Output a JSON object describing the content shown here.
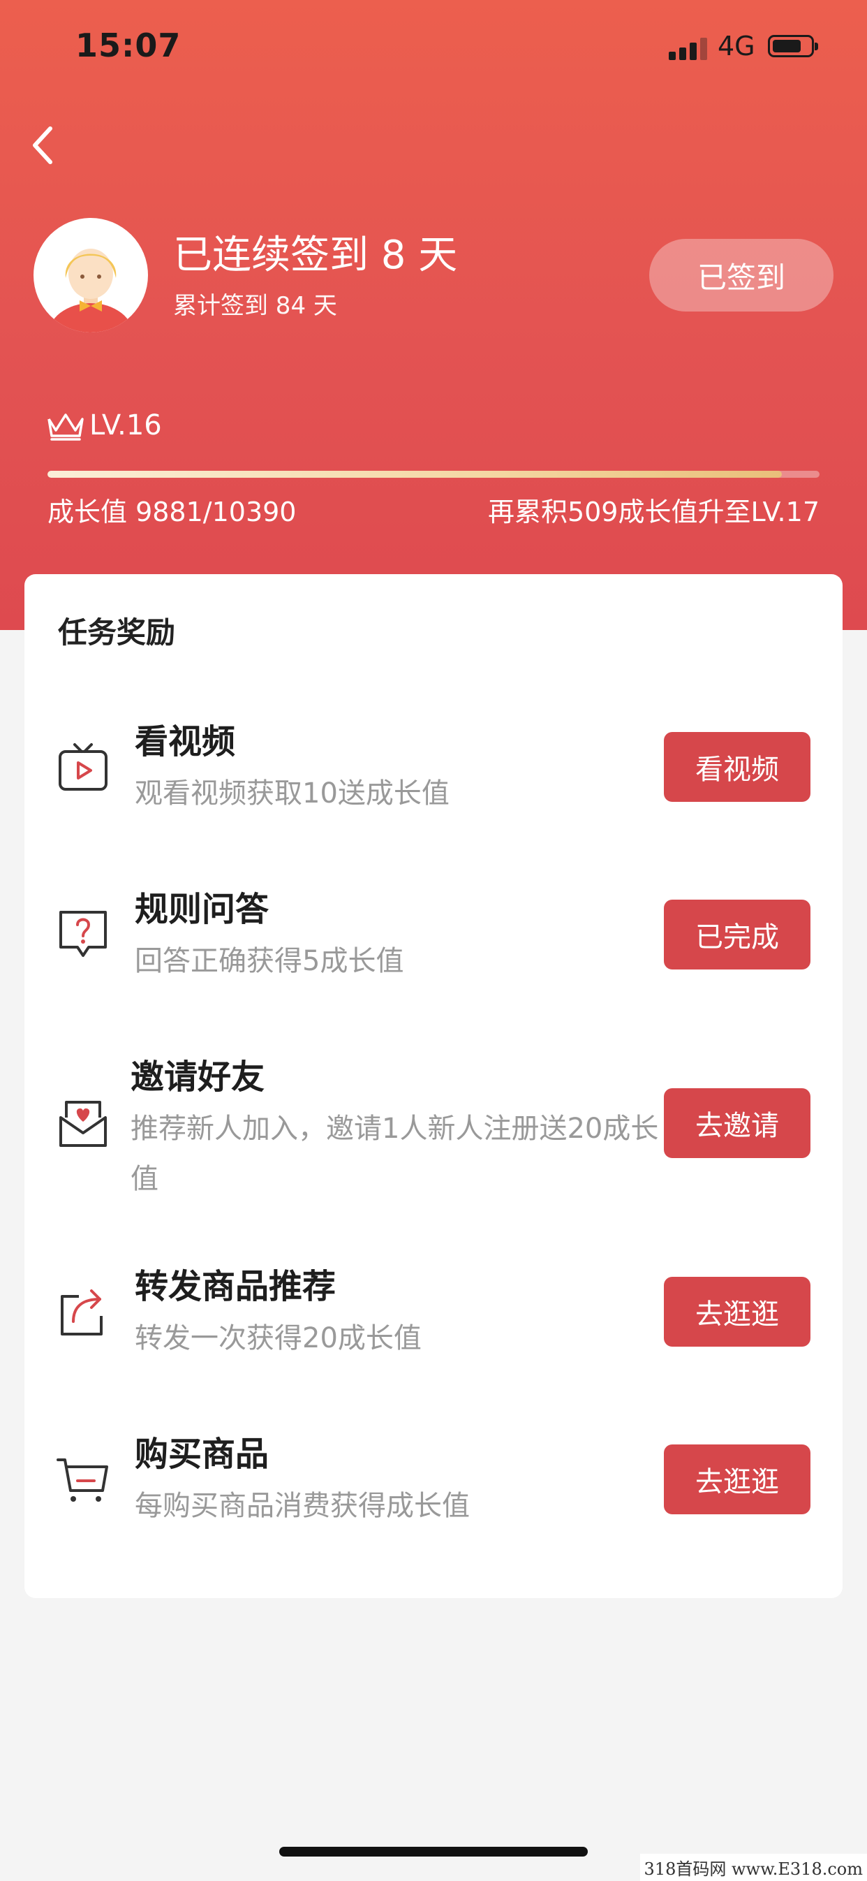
{
  "status_bar": {
    "time": "15:07",
    "network": "4G"
  },
  "profile": {
    "streak_title": "已连续签到 8 天",
    "total_text": "累计签到 84 天",
    "sign_button_label": "已签到"
  },
  "level": {
    "label": "LV.16",
    "progress_fraction": 0.951,
    "growth_text": "成长值 9881/10390",
    "next_level_text": "再累积509成长值升至LV.17"
  },
  "tasks_section": {
    "title": "任务奖励",
    "items": [
      {
        "name": "看视频",
        "desc": "观看视频获取10送成长值",
        "button": "看视频",
        "icon": "tv-play-icon"
      },
      {
        "name": "规则问答",
        "desc": "回答正确获得5成长值",
        "button": "已完成",
        "icon": "question-bubble-icon"
      },
      {
        "name": "邀请好友",
        "desc": "推荐新人加入，邀请1人新人注册送20成长值",
        "button": "去邀请",
        "icon": "envelope-heart-icon"
      },
      {
        "name": "转发商品推荐",
        "desc": "转发一次获得20成长值",
        "button": "去逛逛",
        "icon": "share-arrow-icon"
      },
      {
        "name": "购买商品",
        "desc": "每购买商品消费获得成长值",
        "button": "去逛逛",
        "icon": "cart-icon"
      }
    ]
  },
  "watermark": "318首码网 www.E318.com",
  "colors": {
    "header_top": "#ec5f4e",
    "header_bottom": "#de4a4f",
    "accent": "#d6474b",
    "progress": "#f4d7a3"
  }
}
